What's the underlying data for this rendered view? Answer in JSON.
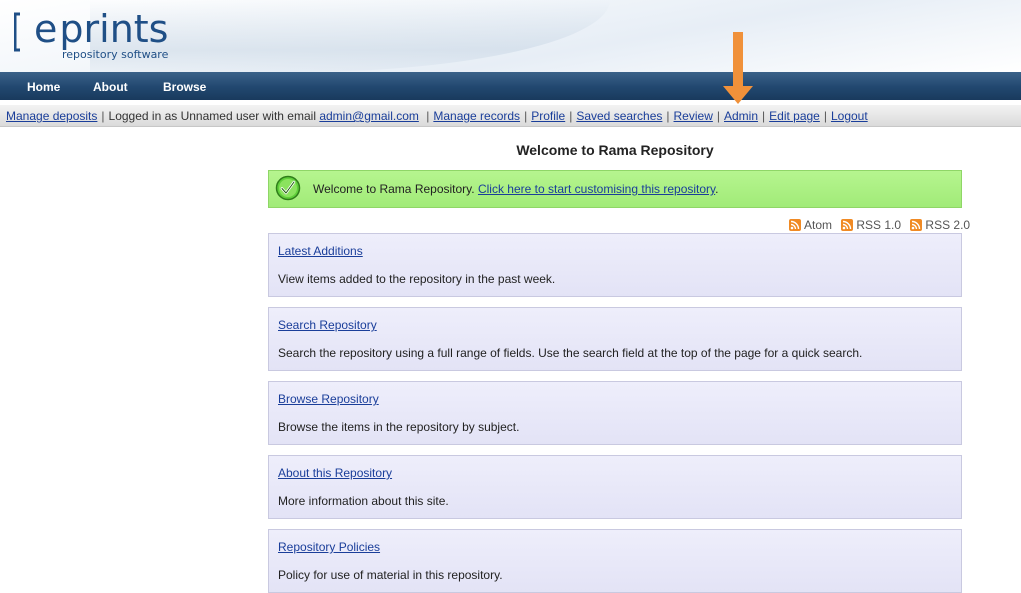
{
  "logo": {
    "word": "prints",
    "letter": "e",
    "tagline": "repository software"
  },
  "nav": {
    "items": [
      "Home",
      "About",
      "Browse"
    ]
  },
  "util": {
    "manage_deposits": "Manage deposits",
    "logged_in_text": "Logged in as Unnamed user with email",
    "email": "admin@gmail.com",
    "links": [
      "Manage records",
      "Profile",
      "Saved searches",
      "Review",
      "Admin",
      "Edit page",
      "Logout"
    ]
  },
  "main": {
    "title": "Welcome to Rama Repository",
    "message": {
      "text": "Welcome to Rama Repository.",
      "link": "Click here to start customising this repository",
      "end": "."
    },
    "feeds": [
      "Atom",
      "RSS 1.0",
      "RSS 2.0"
    ],
    "boxes": [
      {
        "title": "Latest Additions",
        "desc": "View items added to the repository in the past week."
      },
      {
        "title": "Search Repository",
        "desc": "Search the repository using a full range of fields. Use the search field at the top of the page for a quick search."
      },
      {
        "title": "Browse Repository",
        "desc": "Browse the items in the repository by subject."
      },
      {
        "title": "About this Repository",
        "desc": "More information about this site."
      },
      {
        "title": "Repository Policies",
        "desc": "Policy for use of material in this repository."
      }
    ]
  },
  "colors": {
    "nav_bg": "#21476f",
    "message_bg": "#a8f07f",
    "box_bg": "#e8e8f8",
    "arrow": "#f0913a",
    "link": "#1a3e9a",
    "feed_icon": "#f08a24"
  },
  "icons": {
    "check": "check-circle-icon",
    "feed": "rss-icon",
    "annotation": "orange-arrow"
  }
}
